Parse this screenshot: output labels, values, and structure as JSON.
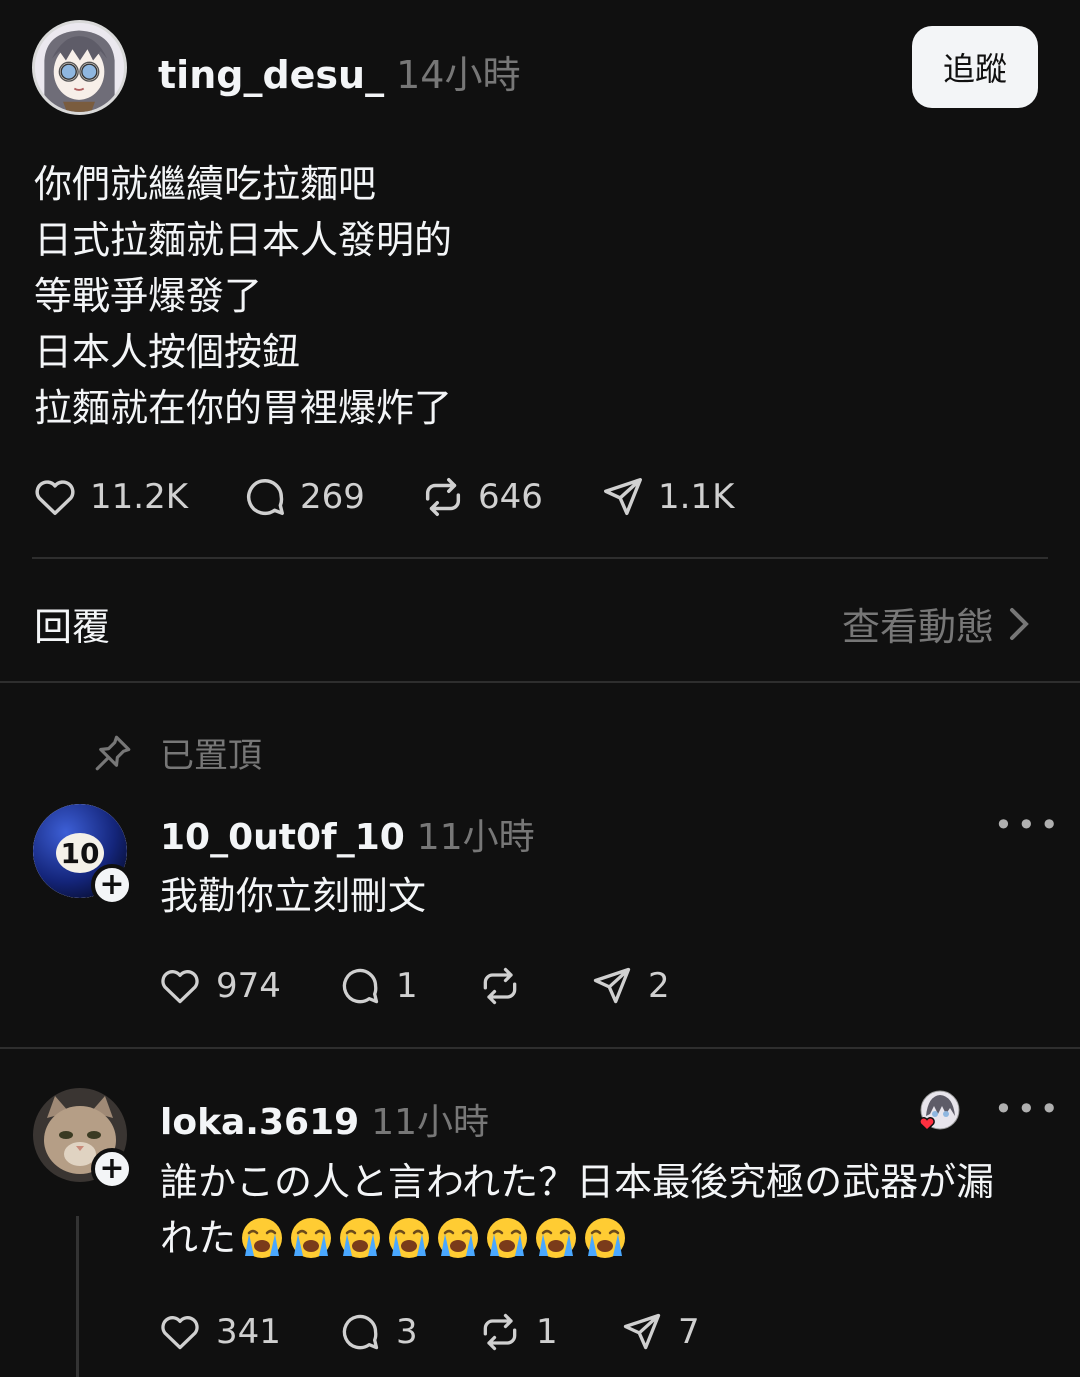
{
  "post": {
    "username": "ting_desu_",
    "time": "14小時",
    "follow_label": "追蹤",
    "lines": [
      "你們就繼續吃拉麵吧",
      "日式拉麵就日本人發明的",
      "等戰爭爆發了",
      "日本人按個按鈕",
      "拉麵就在你的胃裡爆炸了"
    ],
    "likes": "11.2K",
    "comments": "269",
    "reposts": "646",
    "shares": "1.1K"
  },
  "replies_header": {
    "label": "回覆",
    "activity_label": "查看動態"
  },
  "pinned_label": "已置頂",
  "replies": [
    {
      "username": "10_0ut0f_10",
      "time": "11小時",
      "text": "我勸你立刻刪文",
      "avatar_text": "10",
      "likes": "974",
      "comments": "1",
      "reposts": "",
      "shares": "2"
    },
    {
      "username": "loka.3619",
      "time": "11小時",
      "text_line1": "誰かこの人と言われた？日本最後究極の武器が漏",
      "text_line2": "れた",
      "emoji_count": 8,
      "likes": "341",
      "comments": "3",
      "reposts": "1",
      "shares": "7"
    }
  ],
  "colors": {
    "background": "#101010",
    "text": "#f3f5f7",
    "secondary": "#777777",
    "divider": "#2e2e2e",
    "heart": "#ff3040"
  },
  "icons": [
    "heart-icon",
    "comment-icon",
    "repost-icon",
    "share-icon",
    "pin-icon",
    "chevron-right-icon",
    "more-icon",
    "plus-icon",
    "crying-emoji"
  ]
}
